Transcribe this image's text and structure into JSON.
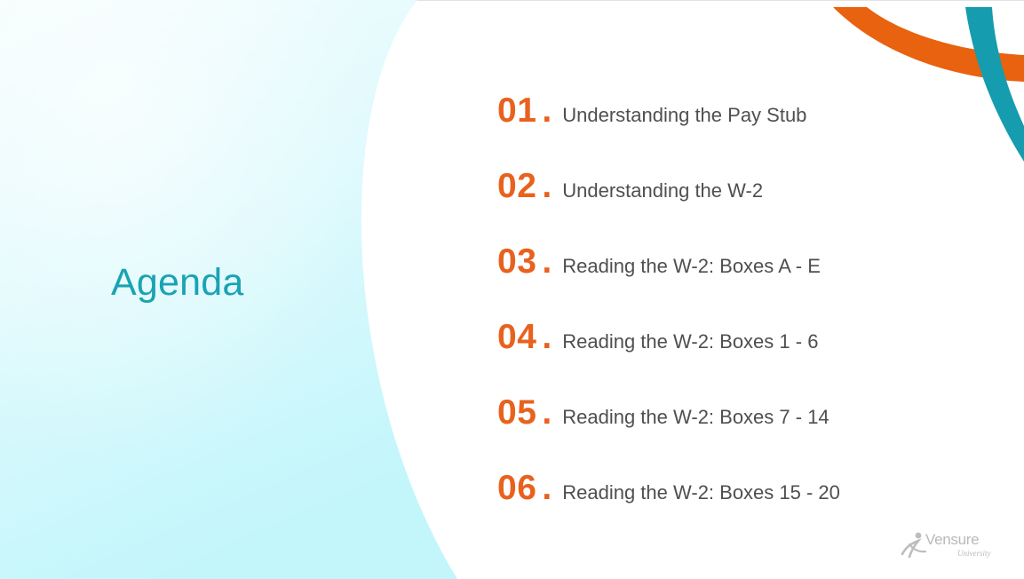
{
  "slide": {
    "title": "Agenda",
    "items": [
      {
        "number": "01",
        "label": "Understanding the Pay Stub"
      },
      {
        "number": "02",
        "label": "Understanding the W-2"
      },
      {
        "number": "03",
        "label": "Reading the W-2: Boxes A - E"
      },
      {
        "number": "04",
        "label": "Reading the W-2: Boxes 1 - 6"
      },
      {
        "number": "05",
        "label": "Reading the W-2: Boxes 7 - 14"
      },
      {
        "number": "06",
        "label": "Reading the W-2: Boxes 15 - 20"
      }
    ],
    "logo": {
      "name": "Vensure",
      "subtitle": "University"
    }
  },
  "colors": {
    "title": "#1aa3b3",
    "number": "#e8621e",
    "label": "#4f4f4f",
    "panel_light": "#f4fdfe",
    "panel_dark": "#c3f6fb",
    "accent_orange": "#e8620f",
    "accent_teal": "#159cae"
  }
}
